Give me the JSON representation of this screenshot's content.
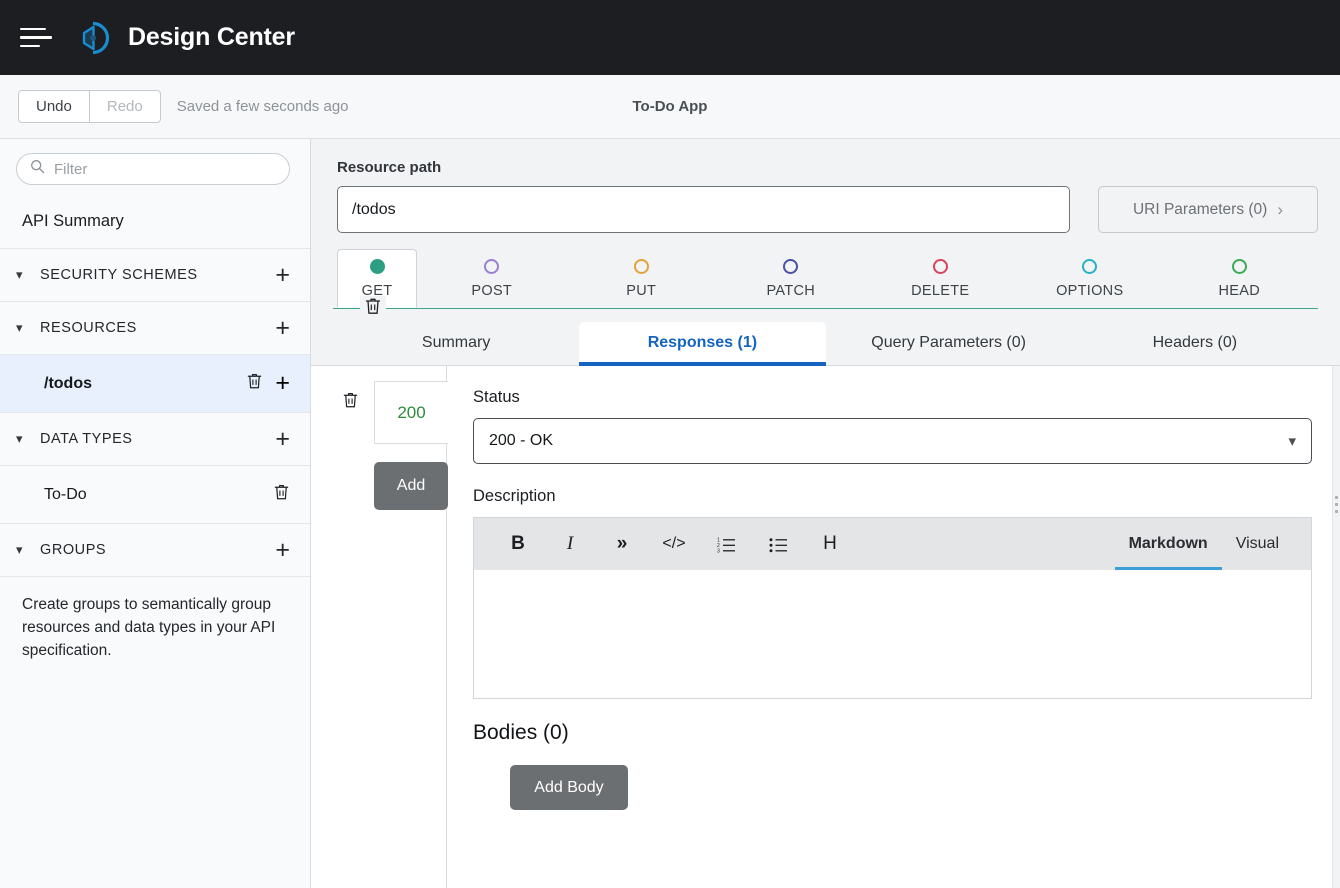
{
  "topbar": {
    "menu_icon": "hamburger-icon",
    "logo_icon": "mulesoft-logo-icon",
    "title": "Design Center"
  },
  "toolbar": {
    "undo_label": "Undo",
    "redo_label": "Redo",
    "saved_text": "Saved a few seconds ago",
    "project_title": "To-Do App"
  },
  "sidebar": {
    "filter_placeholder": "Filter",
    "filter_value": "",
    "search_icon": "search-icon",
    "api_summary_label": "API Summary",
    "sections": [
      {
        "label": "SECURITY SCHEMES",
        "chevron": "chevron-down-icon",
        "add_icon": "plus-icon"
      },
      {
        "label": "RESOURCES",
        "chevron": "chevron-down-icon",
        "add_icon": "plus-icon"
      },
      {
        "label": "DATA TYPES",
        "chevron": "chevron-down-icon",
        "add_icon": "plus-icon"
      },
      {
        "label": "GROUPS",
        "chevron": "chevron-down-icon",
        "add_icon": "plus-icon"
      }
    ],
    "resource_item": {
      "label": "/todos",
      "delete_icon": "trash-icon",
      "add_icon": "plus-icon"
    },
    "datatype_item": {
      "label": "To-Do",
      "delete_icon": "trash-icon"
    },
    "groups_description": "Create groups to semantically group resources and data types in your API specification."
  },
  "main": {
    "resource_path_label": "Resource path",
    "resource_path_value": "/todos",
    "uri_parameters_label": "URI Parameters (0)",
    "uri_chevron_icon": "chevron-right-icon",
    "method_delete_icon": "trash-icon",
    "methods": [
      {
        "label": "GET",
        "color": "#2e9e83",
        "selected": true
      },
      {
        "label": "POST",
        "color": "#9b7fd4",
        "selected": false
      },
      {
        "label": "PUT",
        "color": "#e2a33b",
        "selected": false
      },
      {
        "label": "PATCH",
        "color": "#4a4fa8",
        "selected": false
      },
      {
        "label": "DELETE",
        "color": "#d6445a",
        "selected": false
      },
      {
        "label": "OPTIONS",
        "color": "#26b0c9",
        "selected": false
      },
      {
        "label": "HEAD",
        "color": "#3caa55",
        "selected": false
      }
    ],
    "tabs": [
      {
        "label": "Summary",
        "active": false
      },
      {
        "label": "Responses (1)",
        "active": true
      },
      {
        "label": "Query Parameters (0)",
        "active": false
      },
      {
        "label": "Headers (0)",
        "active": false
      }
    ]
  },
  "response_panel": {
    "delete_icon": "trash-icon",
    "status_code": "200",
    "add_label": "Add",
    "status_label": "Status",
    "status_value": "200 - OK",
    "status_chevron_icon": "chevron-down-icon",
    "description_label": "Description",
    "toolbar_tools": [
      {
        "name": "bold-icon",
        "glyph": "B"
      },
      {
        "name": "italic-icon",
        "glyph": "I"
      },
      {
        "name": "quote-icon",
        "glyph": "»"
      },
      {
        "name": "code-icon",
        "glyph": "</>"
      },
      {
        "name": "numbered-list-icon",
        "glyph": "③"
      },
      {
        "name": "bullet-list-icon",
        "glyph": "☰"
      },
      {
        "name": "heading-icon",
        "glyph": "H"
      }
    ],
    "editor_value": "",
    "mode_markdown": "Markdown",
    "mode_visual": "Visual",
    "bodies_title": "Bodies (0)",
    "add_body_label": "Add Body"
  },
  "colors": {
    "accent_blue": "#1464c0",
    "method_line": "#3ea58c",
    "status_green": "#2e8b3c",
    "logo_blue": "#1a8cd0"
  }
}
